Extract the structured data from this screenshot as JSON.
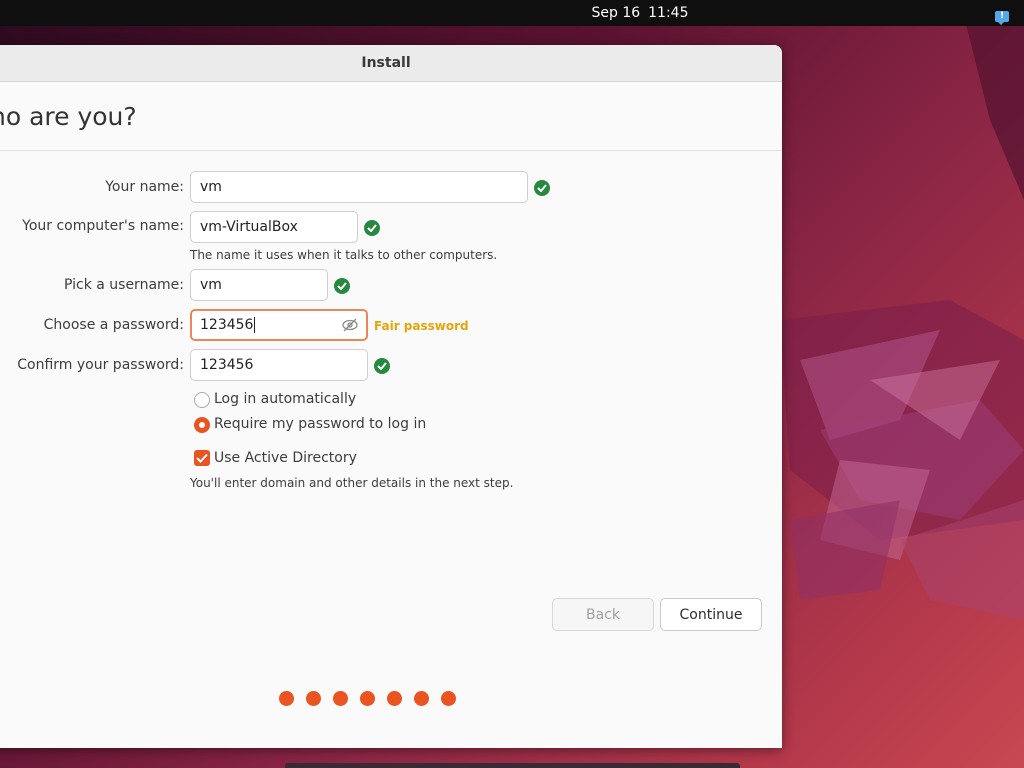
{
  "topbar": {
    "date": "Sep 16",
    "time": "11:45"
  },
  "window": {
    "title": "Install"
  },
  "page": {
    "heading": "ho are you?"
  },
  "form": {
    "name": {
      "label": "Your name:",
      "value": "vm"
    },
    "computer": {
      "label": "Your computer's name:",
      "value": "vm-VirtualBox",
      "hint": "The name it uses when it talks to other computers."
    },
    "username": {
      "label": "Pick a username:",
      "value": "vm"
    },
    "password": {
      "label": "Choose a password:",
      "value": "123456",
      "strength": "Fair password"
    },
    "confirm": {
      "label": "Confirm your password:",
      "value": "123456"
    },
    "login_options": [
      {
        "label": "Log in automatically",
        "selected": false
      },
      {
        "label": "Require my password to log in",
        "selected": true
      }
    ],
    "active_directory": {
      "label": "Use Active Directory",
      "checked": true,
      "hint": "You'll enter domain and other details in the next step."
    }
  },
  "buttons": {
    "back": "Back",
    "continue": "Continue"
  },
  "progress": {
    "steps": 7
  },
  "colors": {
    "accent": "#e95420",
    "success": "#27883f",
    "warning": "#e5a50a"
  }
}
